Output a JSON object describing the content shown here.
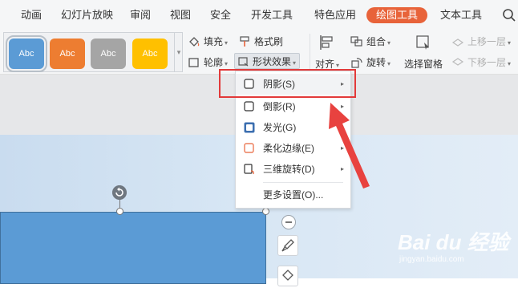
{
  "tabs": [
    {
      "label": "动画",
      "active": false
    },
    {
      "label": "幻灯片放映",
      "active": false
    },
    {
      "label": "审阅",
      "active": false
    },
    {
      "label": "视图",
      "active": false
    },
    {
      "label": "安全",
      "active": false
    },
    {
      "label": "开发工具",
      "active": false
    },
    {
      "label": "特色应用",
      "active": false
    },
    {
      "label": "绘图工具",
      "active": true
    },
    {
      "label": "文本工具",
      "active": false
    }
  ],
  "ribbon": {
    "style_gallery": [
      {
        "label": "Abc",
        "color": "#5b9bd5"
      },
      {
        "label": "Abc",
        "color": "#ed7d31"
      },
      {
        "label": "Abc",
        "color": "#a5a5a5"
      },
      {
        "label": "Abc",
        "color": "#ffc000"
      }
    ],
    "fill": "填充",
    "outline": "轮廓",
    "format_painter": "格式刷",
    "shape_effects": "形状效果",
    "align": "对齐",
    "group": "组合",
    "rotate": "旋转",
    "selection_pane": "选择窗格",
    "bring_forward": "上移一层",
    "send_backward": "下移一层"
  },
  "menu": {
    "items": [
      {
        "label": "阴影(S)",
        "has_submenu": true,
        "icon": "shadow-icon"
      },
      {
        "label": "倒影(R)",
        "has_submenu": true,
        "icon": "reflection-icon"
      },
      {
        "label": "发光(G)",
        "has_submenu": true,
        "icon": "glow-icon"
      },
      {
        "label": "柔化边缘(E)",
        "has_submenu": true,
        "icon": "soft-edge-icon"
      },
      {
        "label": "三维旋转(D)",
        "has_submenu": true,
        "icon": "3d-rotation-icon"
      }
    ],
    "more": "更多设置(O)..."
  },
  "watermark": {
    "main": "Bai du 经验",
    "sub": "jingyan.baidu.com"
  },
  "colors": {
    "accent": "#e8633a",
    "highlight": "#e23a3a",
    "shape_fill": "#5b9bd5"
  }
}
